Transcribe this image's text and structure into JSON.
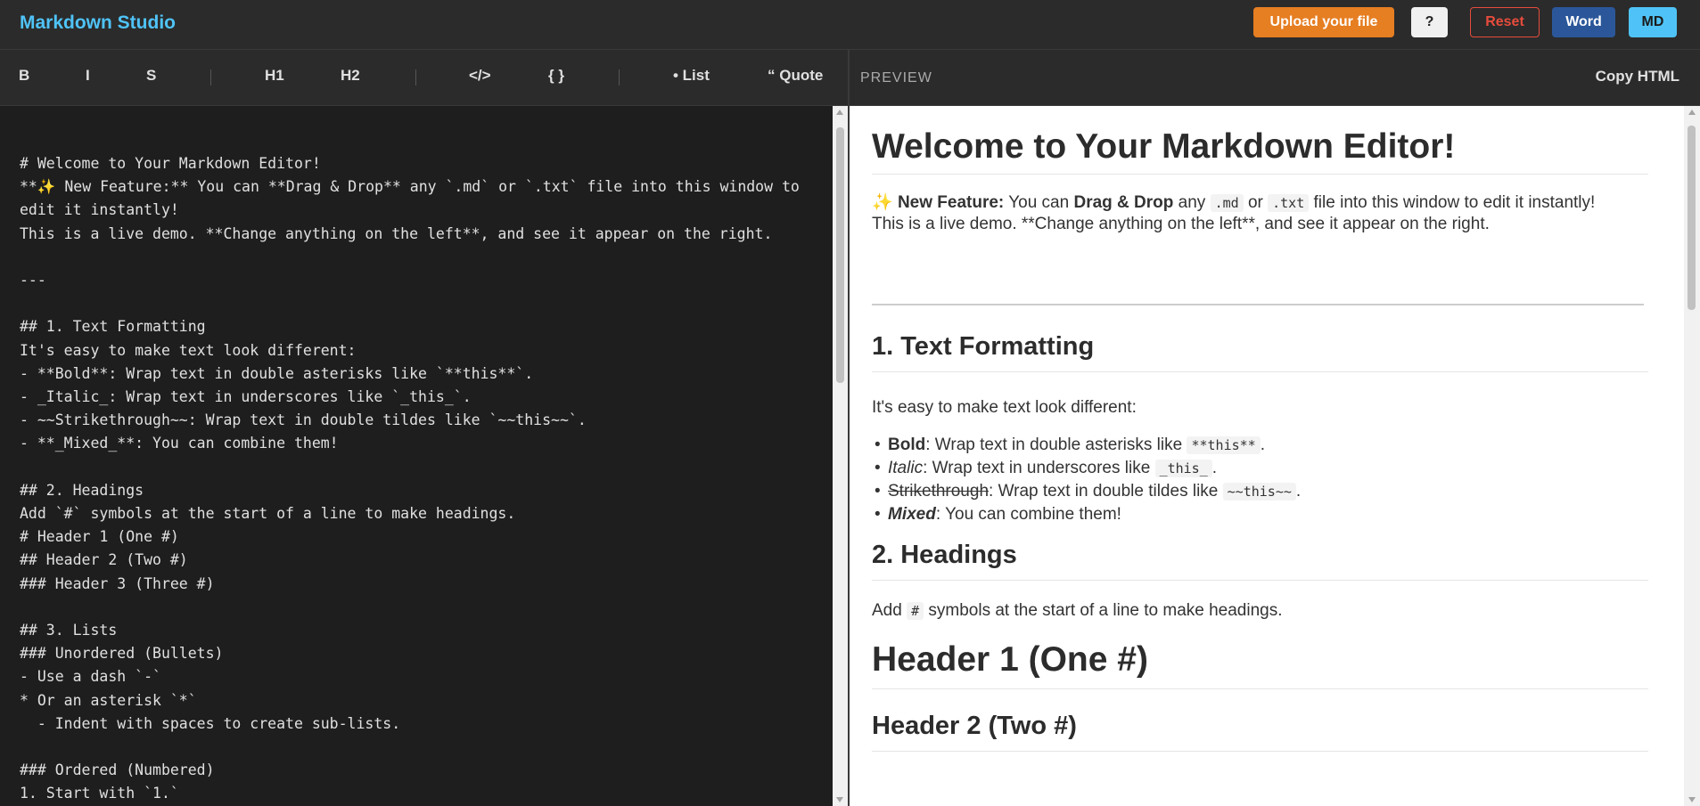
{
  "header": {
    "title": "Markdown Studio",
    "upload_label": "Upload your file",
    "help_label": "?",
    "reset_label": "Reset",
    "word_label": "Word",
    "md_label": "MD"
  },
  "toolbar": {
    "bold": "B",
    "italic": "I",
    "strike": "S",
    "h1": "H1",
    "h2": "H2",
    "code": "</>",
    "code_block": "{ }",
    "list": "• List",
    "quote": "“ Quote"
  },
  "preview_header": {
    "label": "PREVIEW",
    "copy_html": "Copy HTML"
  },
  "editor": {
    "content": "# Welcome to Your Markdown Editor!\n**✨ New Feature:** You can **Drag & Drop** any `.md` or `.txt` file into this window to\nedit it instantly!\nThis is a live demo. **Change anything on the left**, and see it appear on the right.\n\n---\n\n## 1. Text Formatting\nIt's easy to make text look different:\n- **Bold**: Wrap text in double asterisks like `**this**`.\n- _Italic_: Wrap text in underscores like `_this_`.\n- ~~Strikethrough~~: Wrap text in double tildes like `~~this~~`.\n- **_Mixed_**: You can combine them!\n\n## 2. Headings\nAdd `#` symbols at the start of a line to make headings.\n# Header 1 (One #)\n## Header 2 (Two #)\n### Header 3 (Three #)\n\n## 3. Lists\n### Unordered (Bullets)\n- Use a dash `-`\n* Or an asterisk `*`\n  - Indent with spaces to create sub-lists.\n\n### Ordered (Numbered)\n1. Start with `1.`"
  },
  "preview": {
    "h1": "Welcome to Your Markdown Editor!",
    "feature": {
      "emoji": "✨",
      "bold": "New Feature:",
      "t1": " You can ",
      "b2": "Drag & Drop",
      "t2": " any ",
      "c1": ".md",
      "t3": " or ",
      "c2": ".txt",
      "t4": " file into this window to edit it instantly!"
    },
    "demo_line": "This is a live demo. **Change anything on the left**, and see it appear on the right.",
    "section1": {
      "title": "1. Text Formatting",
      "intro": "It's easy to make text look different:",
      "items": [
        {
          "styled": "Bold",
          "text": ": Wrap text in double asterisks like ",
          "code": "**this**",
          "end": "."
        },
        {
          "styled": "Italic",
          "text": ": Wrap text in underscores like ",
          "code": "_this_",
          "end": "."
        },
        {
          "styled": "Strikethrough",
          "text": ": Wrap text in double tildes like ",
          "code": "~~this~~",
          "end": "."
        },
        {
          "styled": "Mixed",
          "text": ": You can combine them!"
        }
      ]
    },
    "section2": {
      "title": "2. Headings",
      "t1": "Add ",
      "code": "#",
      "t2": " symbols at the start of a line to make headings.",
      "header1": "Header 1 (One #)",
      "header2": "Header 2 (Two #)"
    }
  }
}
